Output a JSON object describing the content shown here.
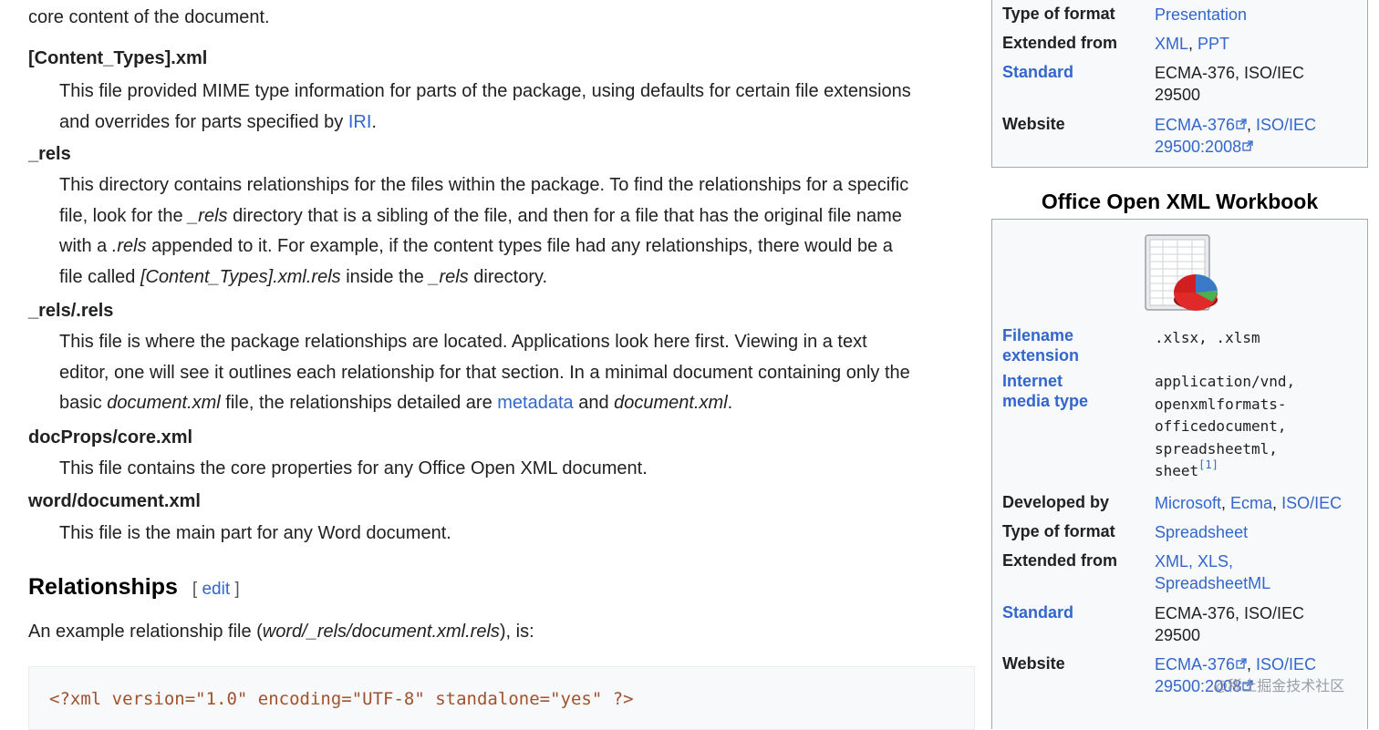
{
  "article": {
    "intro_fragment": "core content of the document.",
    "definitions": [
      {
        "term": "[Content_Types].xml",
        "lines": [
          [
            "This file provided MIME type information for parts of the package, using defaults for certain file extensions"
          ],
          [
            "and overrides for parts specified by ",
            "IRI",
            "."
          ]
        ]
      },
      {
        "term": "_rels",
        "lines": [
          "This directory contains relationships for the files within the package. To find the relationships for a specific",
          [
            "file, look for the ",
            "_rels",
            " directory that is a sibling of the file, and then for a file that has the original file name"
          ],
          [
            "with a ",
            ".rels",
            " appended to it. For example, if the content types file had any relationships, there would be a"
          ],
          [
            "file called ",
            "[Content_Types].xml.rels",
            " inside the ",
            "_rels",
            " directory."
          ]
        ]
      },
      {
        "term": "_rels/.rels",
        "lines": [
          "This file is where the package relationships are located. Applications look here first. Viewing in a text",
          "editor, one will see it outlines each relationship for that section. In a minimal document containing only the",
          [
            "basic ",
            "document.xml",
            " file, the relationships detailed are ",
            "metadata",
            " and ",
            "document.xml",
            "."
          ]
        ]
      },
      {
        "term": "docProps/core.xml",
        "lines": [
          "This file contains the core properties for any Office Open XML document."
        ]
      },
      {
        "term": "word/document.xml",
        "lines": [
          "This file is the main part for any Word document."
        ]
      }
    ],
    "section_heading": "Relationships",
    "edit_open": "[ ",
    "edit_link": "edit",
    "edit_close": " ]",
    "example_prefix": "An example relationship file (",
    "example_file": "word/_rels/document.xml.rels",
    "example_suffix": "), is:",
    "code_line": "<?xml version=\"1.0\" encoding=\"UTF-8\" standalone=\"yes\" ?>"
  },
  "infobox_presentation": {
    "type_of_format_label": "Type of format",
    "type_of_format_value": "Presentation",
    "extended_from_label": "Extended from",
    "extended_from_values": [
      "XML",
      "PPT"
    ],
    "standard_label": "Standard",
    "standard_lines": [
      "ECMA-376, ISO/IEC",
      "29500"
    ],
    "website_label": "Website",
    "website_line1_a": "ECMA-376",
    "website_line1_b": "ISO/IEC",
    "website_line2": "29500:2008"
  },
  "infobox_workbook": {
    "title": "Office Open XML Workbook",
    "image_icon": "spreadsheet-pie-chart-icon",
    "filename_ext_label_lines": [
      "Filename",
      "extension"
    ],
    "filename_ext_value": ".xlsx, .xlsm",
    "media_type_label_lines": [
      "Internet",
      "media type"
    ],
    "media_type_lines": [
      "application/vnd,",
      "openxmlformats-",
      "officedocument,",
      "spreadsheetml,",
      "sheet"
    ],
    "media_type_ref": "[1]",
    "developed_by_label": "Developed by",
    "developed_by_values": [
      "Microsoft",
      "Ecma",
      "ISO/IEC"
    ],
    "type_of_format_label": "Type of format",
    "type_of_format_value": "Spreadsheet",
    "extended_from_label": "Extended from",
    "extended_from_lines": [
      "XML, XLS,",
      "SpreadsheetML"
    ],
    "standard_label": "Standard",
    "standard_lines": [
      "ECMA-376, ISO/IEC",
      "29500"
    ],
    "website_label": "Website",
    "website_line1_a": "ECMA-376",
    "website_line1_b": "ISO/IEC",
    "website_line2": "29500:2008"
  },
  "watermark": "@稀土掘金技术社区",
  "colors": {
    "link": "#3366cc",
    "text": "#202122",
    "infobox_bg": "#f8f9fa",
    "infobox_border": "#a2a9b1",
    "code_text": "#a0522d"
  }
}
